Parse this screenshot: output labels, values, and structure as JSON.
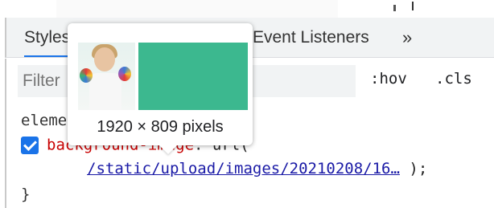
{
  "tabs": {
    "styles": "Styles",
    "event_listeners": "Event Listeners",
    "more": "»"
  },
  "filter": {
    "placeholder": "Filter",
    "hov": ":hov",
    "cls": ".cls"
  },
  "rule": {
    "selector": "element.style {",
    "property": "background-image",
    "colon": ":",
    "value_prefix": " url(",
    "url": "/static/upload/images/20210208/16…",
    "value_suffix": " );",
    "close_brace": "}",
    "checked": true
  },
  "tooltip": {
    "dimensions": "1920 × 809 pixels"
  },
  "colors": {
    "accent": "#1a73e8",
    "property_name": "#c80000",
    "url_link": "#1a1aa6",
    "thumbnail_green": "#3cb88f"
  },
  "icons": {
    "checkbox": "checked-checkbox-icon",
    "more": "chevron-double-right-icon"
  }
}
